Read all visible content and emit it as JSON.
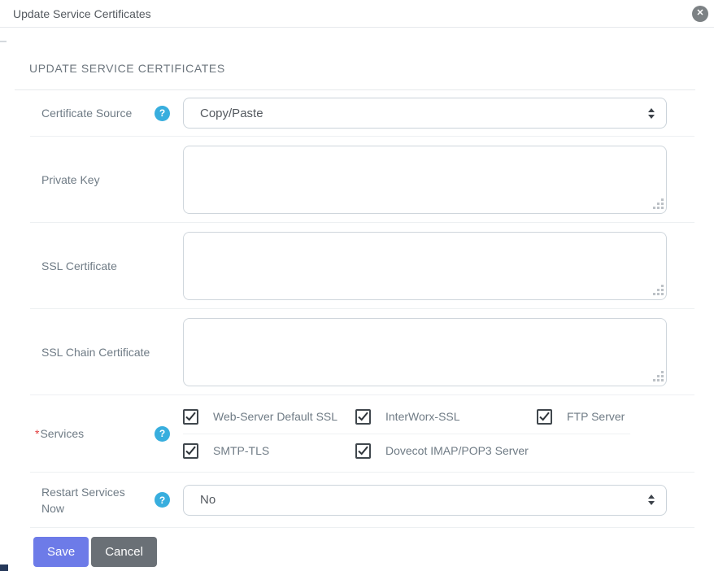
{
  "modal": {
    "title": "Update Service Certificates"
  },
  "section": {
    "heading": "UPDATE SERVICE CERTIFICATES"
  },
  "form": {
    "certificate_source": {
      "label": "Certificate Source",
      "value": "Copy/Paste",
      "control": "select"
    },
    "private_key": {
      "label": "Private Key",
      "value": "",
      "control": "textarea"
    },
    "ssl_certificate": {
      "label": "SSL Certificate",
      "value": "",
      "control": "textarea"
    },
    "ssl_chain_certificate": {
      "label": "SSL Chain Certificate",
      "value": "",
      "control": "textarea"
    },
    "services": {
      "label": "Services",
      "required_marker": "*",
      "items": [
        {
          "label": "Web-Server Default SSL",
          "checked": true
        },
        {
          "label": "InterWorx-SSL",
          "checked": true
        },
        {
          "label": "FTP Server",
          "checked": true
        },
        {
          "label": "SMTP-TLS",
          "checked": true
        },
        {
          "label": "Dovecot IMAP/POP3 Server",
          "checked": true
        }
      ]
    },
    "restart_services_now": {
      "label": "Restart Services Now",
      "value": "No",
      "control": "select"
    }
  },
  "buttons": {
    "save": "Save",
    "cancel": "Cancel"
  },
  "icons": {
    "close": "x-circle",
    "help": "question-circle",
    "select": "up-down-arrows",
    "checkbox": "checkmark",
    "textarea_grip": "resize-dots"
  },
  "colors": {
    "help_icon": "#38aede",
    "save_button": "#6d7be8",
    "cancel_button": "#6a7076",
    "close_button": "#7c8184",
    "label_text": "#6f7b85",
    "checkbox_border": "#40474d",
    "required_marker": "#e23b3b",
    "corner_accent": "#26395a"
  }
}
